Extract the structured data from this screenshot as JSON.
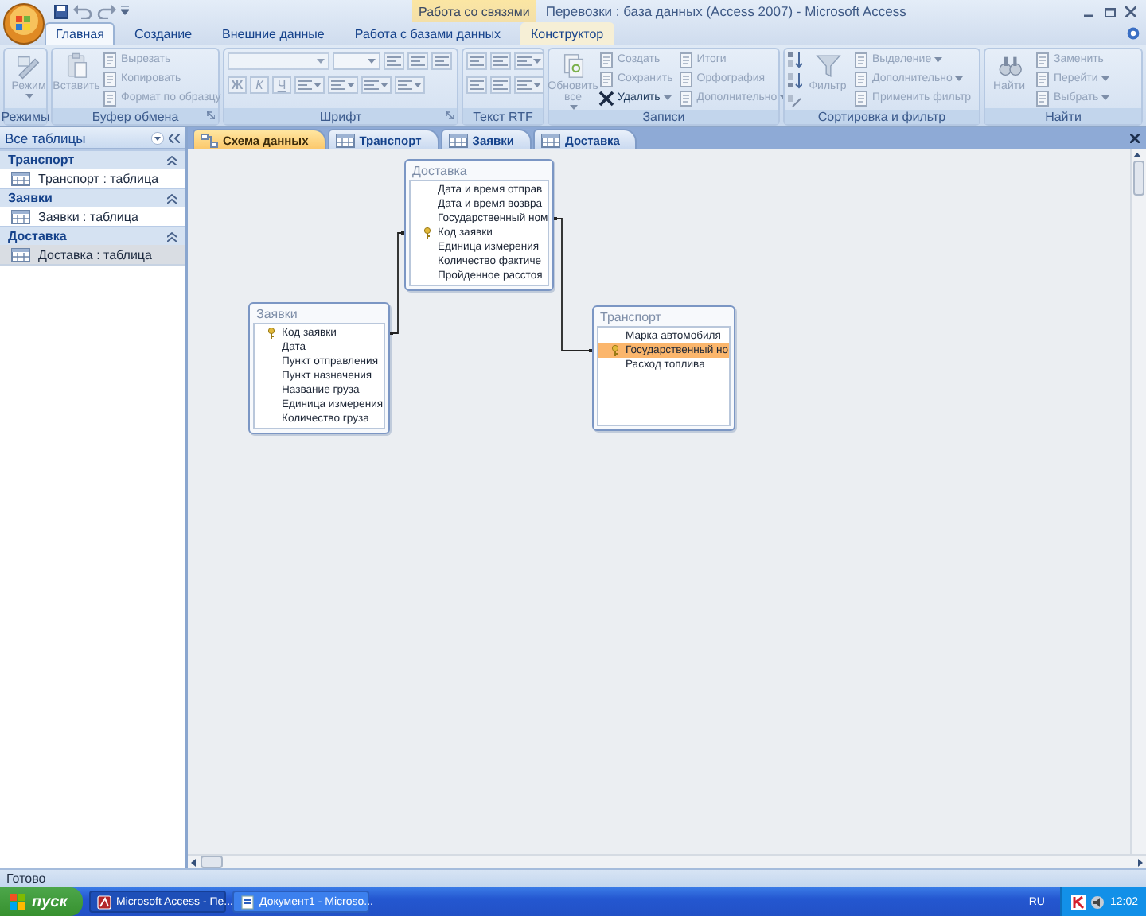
{
  "window": {
    "title": "Перевозки : база данных (Access 2007) - Microsoft Access",
    "context_group": "Работа со связями"
  },
  "ribbon_tabs": [
    {
      "label": "Главная",
      "selected": true,
      "context": false
    },
    {
      "label": "Создание",
      "selected": false,
      "context": false
    },
    {
      "label": "Внешние данные",
      "selected": false,
      "context": false
    },
    {
      "label": "Работа с базами данных",
      "selected": false,
      "context": false
    },
    {
      "label": "Конструктор",
      "selected": false,
      "context": true
    }
  ],
  "ribbon_groups": [
    {
      "title": "Режимы",
      "items": [
        {
          "kind": "large",
          "label": "Режим",
          "disabled": true
        }
      ]
    },
    {
      "title": "Буфер обмена",
      "items": [
        {
          "kind": "large",
          "label": "Вставить",
          "disabled": true
        },
        {
          "kind": "small",
          "label": "Вырезать",
          "disabled": true
        },
        {
          "kind": "small",
          "label": "Копировать",
          "disabled": true
        },
        {
          "kind": "small",
          "label": "Формат по образцу",
          "disabled": true
        }
      ]
    },
    {
      "title": "Шрифт",
      "items": [
        {
          "kind": "combo",
          "disabled": true
        },
        {
          "kind": "toggle",
          "label": "Ж",
          "disabled": true
        },
        {
          "kind": "toggle",
          "label": "К",
          "disabled": true
        },
        {
          "kind": "toggle",
          "label": "Ч",
          "disabled": true
        }
      ]
    },
    {
      "title": "Текст RTF"
    },
    {
      "title": "Записи",
      "items": [
        {
          "kind": "large",
          "label": "Обновить все",
          "disabled": true
        },
        {
          "kind": "small",
          "label": "Создать",
          "disabled": true
        },
        {
          "kind": "small",
          "label": "Сохранить",
          "disabled": true
        },
        {
          "kind": "small",
          "label": "Удалить",
          "disabled": false
        },
        {
          "kind": "small",
          "label": "Итоги",
          "disabled": true
        },
        {
          "kind": "small",
          "label": "Орфография",
          "disabled": true
        },
        {
          "kind": "small",
          "label": "Дополнительно",
          "disabled": true
        }
      ]
    },
    {
      "title": "Сортировка и фильтр",
      "items": [
        {
          "kind": "large",
          "label": "Фильтр",
          "disabled": true
        },
        {
          "kind": "small",
          "label": "Выделение",
          "disabled": true
        },
        {
          "kind": "small",
          "label": "Дополнительно",
          "disabled": true
        },
        {
          "kind": "small",
          "label": "Применить фильтр",
          "disabled": true
        }
      ]
    },
    {
      "title": "Найти",
      "items": [
        {
          "kind": "large",
          "label": "Найти",
          "disabled": true
        },
        {
          "kind": "small",
          "label": "Заменить",
          "disabled": true
        },
        {
          "kind": "small",
          "label": "Перейти",
          "disabled": true
        },
        {
          "kind": "small",
          "label": "Выбрать",
          "disabled": true
        }
      ]
    }
  ],
  "nav_pane": {
    "header": "Все таблицы",
    "groups": [
      {
        "title": "Транспорт",
        "items": [
          {
            "label": "Транспорт : таблица",
            "selected": false
          }
        ]
      },
      {
        "title": "Заявки",
        "items": [
          {
            "label": "Заявки : таблица",
            "selected": false
          }
        ]
      },
      {
        "title": "Доставка",
        "items": [
          {
            "label": "Доставка : таблица",
            "selected": true
          }
        ]
      }
    ]
  },
  "document_tabs": [
    {
      "label": "Схема данных",
      "selected": true
    },
    {
      "label": "Транспорт",
      "selected": false
    },
    {
      "label": "Заявки",
      "selected": false
    },
    {
      "label": "Доставка",
      "selected": false
    }
  ],
  "diagram": {
    "tables": [
      {
        "title": "Доставка",
        "fields": [
          {
            "name": "Дата и время отправ",
            "key": false,
            "selected": false
          },
          {
            "name": "Дата и время возвра",
            "key": false,
            "selected": false
          },
          {
            "name": "Государственный ном",
            "key": false,
            "selected": false
          },
          {
            "name": "Код заявки",
            "key": true,
            "selected": false
          },
          {
            "name": "Единица измерения",
            "key": false,
            "selected": false
          },
          {
            "name": "Количество фактиче",
            "key": false,
            "selected": false
          },
          {
            "name": "Пройденное расстоя",
            "key": false,
            "selected": false
          }
        ]
      },
      {
        "title": "Заявки",
        "fields": [
          {
            "name": "Код заявки",
            "key": true,
            "selected": false
          },
          {
            "name": "Дата",
            "key": false,
            "selected": false
          },
          {
            "name": "Пункт отправления",
            "key": false,
            "selected": false
          },
          {
            "name": "Пункт назначения",
            "key": false,
            "selected": false
          },
          {
            "name": "Название груза",
            "key": false,
            "selected": false
          },
          {
            "name": "Единица измерения",
            "key": false,
            "selected": false
          },
          {
            "name": "Количество груза",
            "key": false,
            "selected": false
          }
        ]
      },
      {
        "title": "Транспорт",
        "fields": [
          {
            "name": "Марка автомобиля",
            "key": false,
            "selected": false
          },
          {
            "name": "Государственный но",
            "key": true,
            "selected": true
          },
          {
            "name": "Расход топлива",
            "key": false,
            "selected": false
          }
        ]
      }
    ]
  },
  "status_bar": {
    "text": "Готово"
  },
  "taskbar": {
    "start": "пуск",
    "tasks": [
      {
        "label": "Microsoft Access - Пе...",
        "selected": true
      },
      {
        "label": "Документ1 - Microso...",
        "selected": false
      }
    ],
    "language": "RU",
    "clock": "12:02"
  }
}
